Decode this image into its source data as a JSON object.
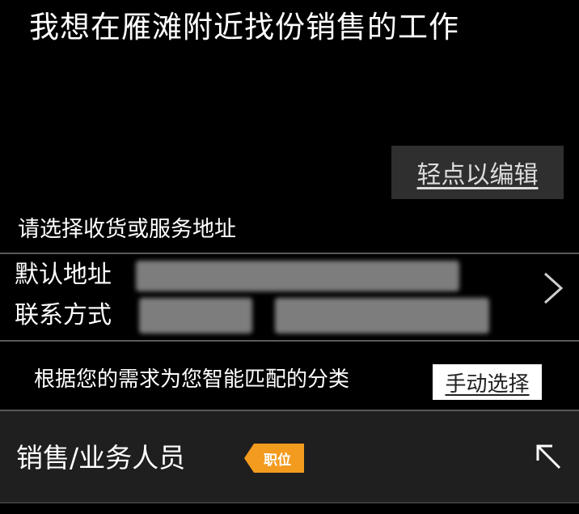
{
  "query": {
    "text": "我想在雁滩附近找份销售的工作"
  },
  "edit_button": {
    "label": "轻点以编辑"
  },
  "address": {
    "title": "请选择收货或服务地址",
    "default_label": "默认地址",
    "contact_label": "联系方式"
  },
  "match": {
    "text": "根据您的需求为您智能匹配的分类",
    "manual_label": "手动选择"
  },
  "result": {
    "name": "销售/业务人员",
    "tag": "职位"
  },
  "icons": {
    "address_arrow": "chevron-right-icon",
    "result_arrow": "arrow-up-left-icon"
  },
  "colors": {
    "background": "#000000",
    "tag": "#f39b1f",
    "edit_button_bg": "#2f2f2f",
    "result_row_bg": "#1f1f1f"
  }
}
